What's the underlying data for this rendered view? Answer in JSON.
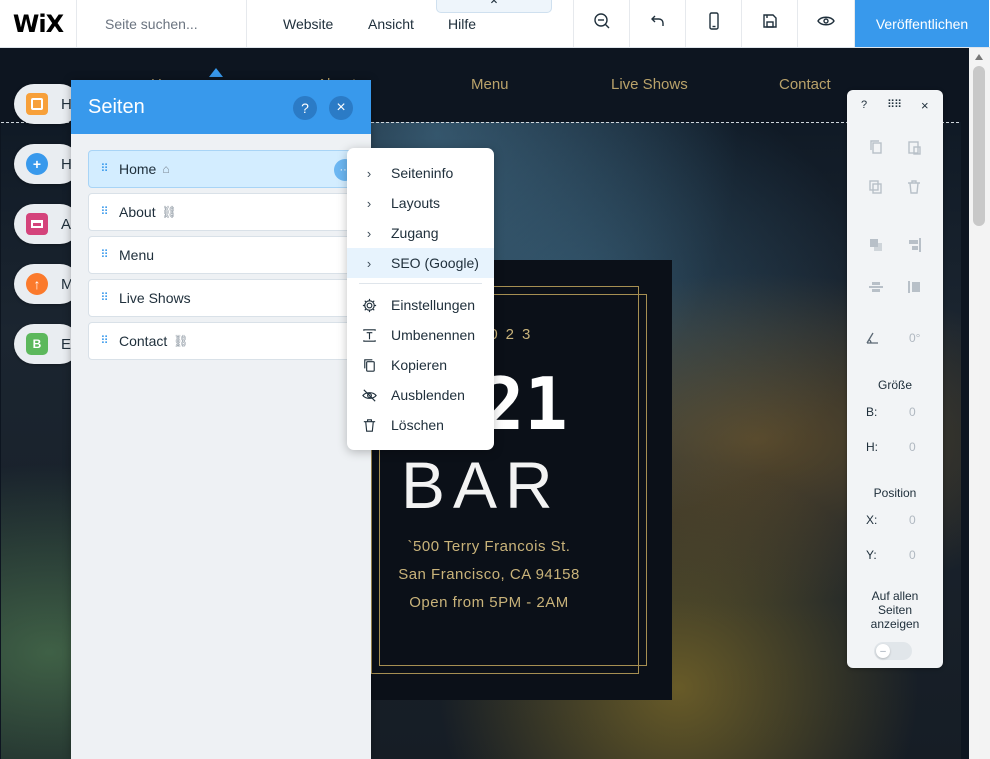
{
  "topbar": {
    "logo": "WiX",
    "search_placeholder": "Seite suchen...",
    "menu": [
      "Website",
      "Ansicht",
      "Hilfe"
    ],
    "menu_tab_chevron": "⌃",
    "tools": [
      "zoom-out-icon",
      "undo-icon",
      "mobile-icon",
      "save-icon",
      "preview-icon"
    ],
    "publish_label": "Veröffentlichen",
    "accent_color": "#3899ec"
  },
  "site": {
    "nav": [
      "Home",
      "About",
      "Menu",
      "Live Shows",
      "Contact"
    ],
    "card": {
      "year": "2023",
      "big": "21",
      "name": "BAR",
      "address_lines": [
        "`500 Terry Francois St.",
        "San Francisco, CA 94158",
        "Open from 5PM - 2AM"
      ]
    }
  },
  "rail": [
    {
      "letter": "H",
      "color": "#f7a03a",
      "icon": "square-icon"
    },
    {
      "letter": "H",
      "color": "#3899ec",
      "icon": "plus-icon"
    },
    {
      "letter": "A",
      "color": "#d4437b",
      "icon": "store-icon"
    },
    {
      "letter": "M",
      "color": "#fb7a2c",
      "icon": "upload-cloud-icon"
    },
    {
      "letter": "E",
      "color": "#5cb85c",
      "icon": "blog-icon",
      "glyph": "B"
    }
  ],
  "pages_panel": {
    "title": "Seiten",
    "help": "?",
    "close": "×",
    "pages": [
      {
        "name": "Home",
        "icon": "home-icon",
        "active": true
      },
      {
        "name": "About",
        "icon": "link-icon",
        "active": false
      },
      {
        "name": "Menu",
        "icon": "",
        "active": false
      },
      {
        "name": "Live Shows",
        "icon": "",
        "active": false
      },
      {
        "name": "Contact",
        "icon": "link-icon",
        "active": false
      }
    ],
    "more_label": "···"
  },
  "context_menu": {
    "submenus": [
      {
        "label": "Seiteninfo",
        "highlighted": false
      },
      {
        "label": "Layouts",
        "highlighted": false
      },
      {
        "label": "Zugang",
        "highlighted": false
      },
      {
        "label": "SEO (Google)",
        "highlighted": true
      }
    ],
    "actions": [
      {
        "label": "Einstellungen",
        "icon": "gear-icon"
      },
      {
        "label": "Umbenennen",
        "icon": "rename-icon"
      },
      {
        "label": "Kopieren",
        "icon": "copy-icon"
      },
      {
        "label": "Ausblenden",
        "icon": "hide-icon"
      },
      {
        "label": "Löschen",
        "icon": "trash-icon"
      }
    ]
  },
  "tool_panel": {
    "help": "?",
    "drag": "⠿⠿",
    "close": "×",
    "rotation": "0°",
    "size_title": "Größe",
    "w_label": "B:",
    "w_value": "0",
    "h_label": "H:",
    "h_value": "0",
    "pos_title": "Position",
    "x_label": "X:",
    "x_value": "0",
    "y_label": "Y:",
    "y_value": "0",
    "show_all_lines": [
      "Auf allen",
      "Seiten",
      "anzeigen"
    ],
    "toggle_glyph": "–"
  }
}
